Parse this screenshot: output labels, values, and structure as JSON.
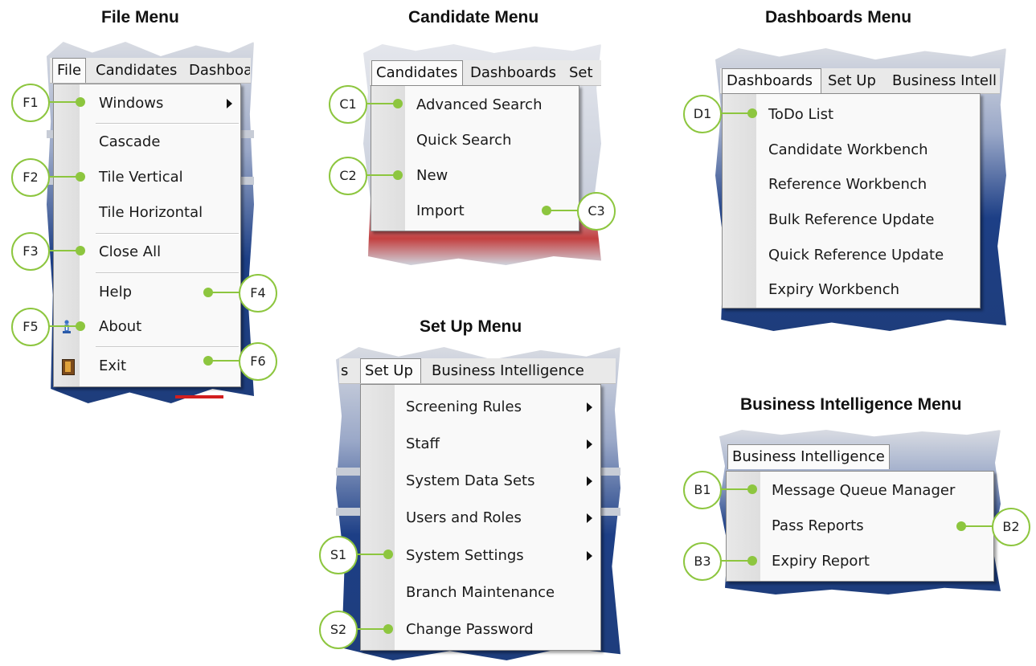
{
  "headings": {
    "file": "File Menu",
    "candidate": "Candidate Menu",
    "dashboards": "Dashboards Menu",
    "setup": "Set Up Menu",
    "bi": "Business Intelligence Menu"
  },
  "file_menu": {
    "menubar": [
      "File",
      "Candidates",
      "Dashboa"
    ],
    "items": {
      "windows": "Windows",
      "cascade": "Cascade",
      "tile_vertical": "Tile Vertical",
      "tile_horizontal": "Tile Horizontal",
      "close_all": "Close All",
      "help": "Help",
      "about": "About",
      "exit": "Exit"
    },
    "callouts": {
      "f1": "F1",
      "f2": "F2",
      "f3": "F3",
      "f4": "F4",
      "f5": "F5",
      "f6": "F6"
    }
  },
  "candidate_menu": {
    "menubar": [
      "Candidates",
      "Dashboards",
      "Set"
    ],
    "items": {
      "advanced_search": "Advanced Search",
      "quick_search": "Quick Search",
      "new": "New",
      "import": "Import"
    },
    "callouts": {
      "c1": "C1",
      "c2": "C2",
      "c3": "C3"
    }
  },
  "dashboards_menu": {
    "menubar": [
      "Dashboards",
      "Set Up",
      "Business Intelli"
    ],
    "items": {
      "todo": "ToDo List",
      "candidate_workbench": "Candidate Workbench",
      "reference_workbench": "Reference Workbench",
      "bulk_reference": "Bulk Reference Update",
      "quick_reference": "Quick Reference Update",
      "expiry_workbench": "Expiry Workbench"
    },
    "callouts": {
      "d1": "D1"
    }
  },
  "setup_menu": {
    "menubar": [
      "s",
      "Set Up",
      "Business Intelligence"
    ],
    "items": {
      "screening_rules": "Screening Rules",
      "staff": "Staff",
      "system_data_sets": "System Data Sets",
      "users_roles": "Users and Roles",
      "system_settings": "System Settings",
      "branch_maintenance": "Branch Maintenance",
      "change_password": "Change Password"
    },
    "callouts": {
      "s1": "S1",
      "s2": "S2"
    }
  },
  "bi_menu": {
    "menubar": [
      "Business Intelligence"
    ],
    "items": {
      "mq_manager": "Message Queue Manager",
      "pass_reports": "Pass Reports",
      "expiry_report": "Expiry Report"
    },
    "callouts": {
      "b1": "B1",
      "b2": "B2",
      "b3": "B3"
    }
  },
  "colors": {
    "callout_green": "#8dc63f",
    "app_blue": "#1d3f86",
    "accent_red": "#d21f1f"
  }
}
